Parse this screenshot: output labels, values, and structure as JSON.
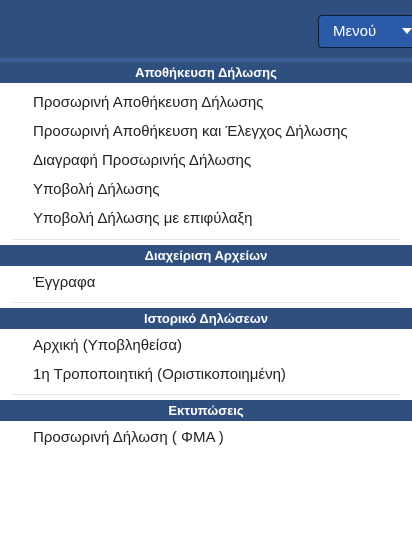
{
  "menu": {
    "label": "Μενού"
  },
  "sections": [
    {
      "title": "Αποθήκευση Δήλωσης",
      "items": [
        "Προσωρινή Αποθήκευση Δήλωσης",
        "Προσωρινή Αποθήκευση και Έλεγχος Δήλωσης",
        "Διαγραφή Προσωρινής Δήλωσης",
        "Υποβολή Δήλωσης",
        "Υποβολή Δήλωσης με επιφύλαξη"
      ]
    },
    {
      "title": "Διαχείριση Αρχείων",
      "items": [
        "Έγγραφα"
      ]
    },
    {
      "title": "Ιστορικό Δηλώσεων",
      "items": [
        "Αρχική (Υποβληθείσα)",
        "1η Τροποποιητική (Οριστικοποιημένη)"
      ]
    },
    {
      "title": "Εκτυπώσεις",
      "items": [
        "Προσωρινή Δήλωση ( ΦΜΑ )"
      ]
    }
  ],
  "colors": {
    "header_bg": "#2f4f7f",
    "menu_button_bg": "#2a5aa8",
    "item_text": "#222222"
  }
}
